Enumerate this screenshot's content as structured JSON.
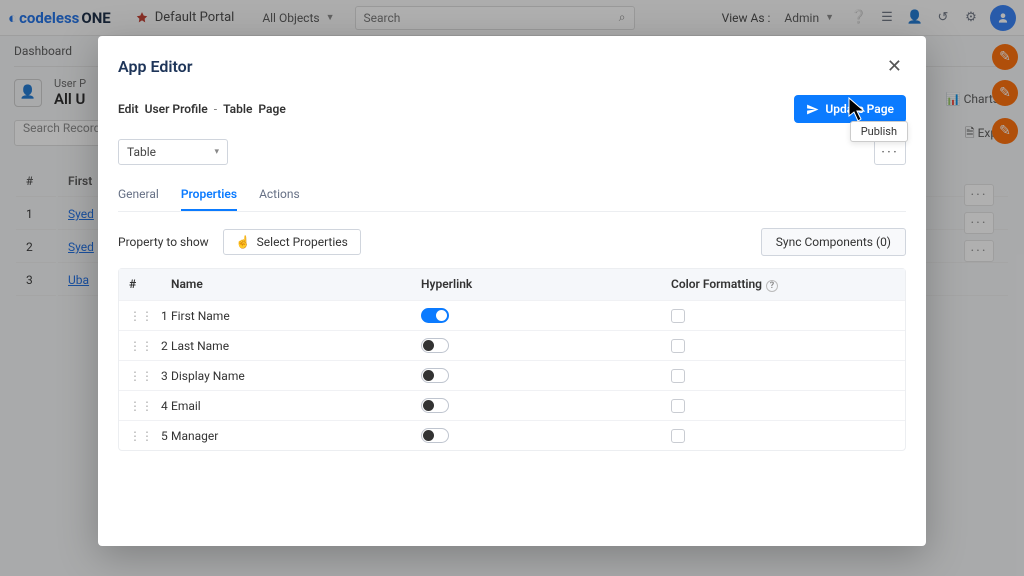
{
  "topbar": {
    "brand_prefix": "codeless",
    "brand_suffix": "ONE",
    "portal": "Default Portal",
    "all_objects": "All Objects",
    "search_placeholder": "Search",
    "view_as_label": "View As :",
    "view_as_value": "Admin"
  },
  "bg": {
    "tab_dashboard": "Dashboard",
    "header_small": "User P",
    "header_big": "All U",
    "search_records": "Search Record",
    "charts_label": "Charts",
    "export_label": "Expor",
    "col_num": "#",
    "col_first": "First"
  },
  "bg_rows": [
    {
      "n": "1",
      "first": "Syed"
    },
    {
      "n": "2",
      "first": "Syed"
    },
    {
      "n": "3",
      "first": "Uba"
    }
  ],
  "modal": {
    "title": "App Editor",
    "crumb_edit": "Edit",
    "crumb_obj": "User Profile",
    "crumb_table": "Table",
    "crumb_page": "Page",
    "update": "Update Page",
    "tooltip": "Publish",
    "select_value": "Table",
    "tab_general": "General",
    "tab_properties": "Properties",
    "tab_actions": "Actions",
    "property_to_show": "Property to show",
    "select_properties": "Select Properties",
    "sync_components": "Sync Components (0)",
    "col_num": "#",
    "col_name": "Name",
    "col_hyperlink": "Hyperlink",
    "col_colorfmt": "Color Formatting"
  },
  "rows": [
    {
      "n": "1",
      "name": "First Name",
      "hyperlink": true
    },
    {
      "n": "2",
      "name": "Last Name",
      "hyperlink": false
    },
    {
      "n": "3",
      "name": "Display Name",
      "hyperlink": false
    },
    {
      "n": "4",
      "name": "Email",
      "hyperlink": false
    },
    {
      "n": "5",
      "name": "Manager",
      "hyperlink": false
    }
  ]
}
